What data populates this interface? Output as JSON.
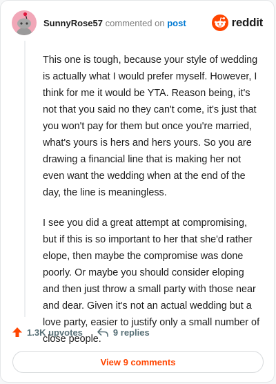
{
  "header": {
    "username": "SunnyRose57",
    "action_text": "commented on",
    "post_link": "post",
    "brand": "reddit"
  },
  "comment": {
    "paragraphs": [
      "This one is tough, because your style of wedding is actually what I would prefer myself. However, I think for me it would be YTA. Reason being, it's not that you said no they can't come, it's just that you won't pay for them but once you're married, what's yours is hers and hers yours. So you are drawing a financial line that is making her not even want the wedding when at the end of the day, the line is meaningless.",
      "I see you did a great attempt at compromising, but if this is so important to her that she'd rather elope, then maybe the compromise was done poorly. Or maybe you should consider eloping and then just throw a small party with those near and dear. Given it's not an actual wedding but a love party, easier to justify only a small number of close people."
    ]
  },
  "footer": {
    "upvotes": "1.3K upvotes",
    "replies": "9 replies",
    "view_comments": "View 9 comments"
  },
  "icons": {
    "upvote": "upvote-arrow-icon",
    "reply": "reply-arrow-icon",
    "brand": "reddit-logo-icon",
    "avatar": "snoo-avatar-icon"
  },
  "colors": {
    "accent": "#ff4500",
    "link": "#0079d3",
    "avatar_bg": "#f1a7b8"
  }
}
